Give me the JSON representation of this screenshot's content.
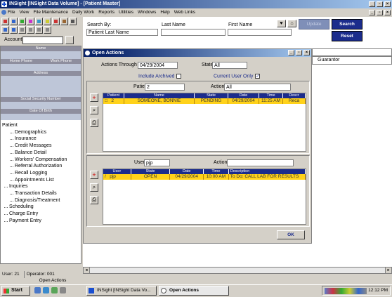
{
  "app": {
    "title": "INSight  [INSight Data Volume] - [Patient Master]",
    "menus": [
      "File",
      "View",
      "File Maintenance",
      "Daily Work",
      "Reports",
      "Utilities",
      "Windows",
      "Help",
      "Web Links"
    ],
    "window_buttons": [
      "_",
      "×"
    ]
  },
  "account": {
    "label": "Account",
    "value": ""
  },
  "sidebar": {
    "headers": {
      "name": "Name",
      "home_phone": "Home Phone",
      "work_phone": "Work Phone",
      "address": "Address",
      "ssn": "Social Security Number",
      "dob": "Date Of Birth"
    },
    "tree": [
      {
        "label": "Patient",
        "level": 0
      },
      {
        "label": "Demographics",
        "level": 2
      },
      {
        "label": "Insurance",
        "level": 2
      },
      {
        "label": "Credit Messages",
        "level": 2
      },
      {
        "label": "Balance Detail",
        "level": 2
      },
      {
        "label": "Workers' Compensation",
        "level": 2
      },
      {
        "label": "Referral Authorization",
        "level": 2
      },
      {
        "label": "Recall Logging",
        "level": 2
      },
      {
        "label": "Appointments List",
        "level": 2
      },
      {
        "label": "Inquiries",
        "level": 1
      },
      {
        "label": "Transaction Details",
        "level": 2
      },
      {
        "label": "Diagnosis/Treatment",
        "level": 2
      },
      {
        "label": "Scheduling",
        "level": 1
      },
      {
        "label": "Charge Entry",
        "level": 1
      },
      {
        "label": "Payment Entry",
        "level": 1
      }
    ]
  },
  "status": {
    "user": "User: 21",
    "operator": "Operator: 001",
    "open_label": "Open Actions"
  },
  "search": {
    "by_label": "Search By:",
    "by_value": "Patient Last Name",
    "last_name_label": "Last Name",
    "first_name_label": "First Name",
    "update_label": "Update",
    "search_label": "Search",
    "reset_label": "Reset"
  },
  "guarantor_label": "Guarantor",
  "dialog": {
    "title": "Open Actions",
    "actions_through_label": "Actions Through",
    "actions_through_value": "04/29/2004",
    "state_label": "State",
    "state_value": "All",
    "include_archived_label": "Include Archived",
    "current_user_only_label": "Current User Only",
    "current_user_only_checked": "✓",
    "patient_label": "Patient",
    "patient_value": "2",
    "action_label": "Action",
    "action_value": "All",
    "patient_grid": {
      "headers": [
        "Patient",
        "Name",
        "State",
        "Date",
        "Time",
        "Descr"
      ],
      "row": [
        "2",
        "SOMEONE, BONNIE",
        "PENDING",
        "04/29/2004",
        "11:25 AM",
        "Reca"
      ],
      "row_marker": "□"
    },
    "user_label": "User",
    "user_value": "pjp",
    "action2_label": "Action",
    "action2_value": "",
    "user_grid": {
      "headers": [
        "User",
        "State",
        "Date",
        "Time",
        "Description"
      ],
      "row": [
        "pjp",
        "OPEN",
        "04/29/2004",
        "10:00 AM",
        "To Do: CALL LAB FOR RESULTS"
      ],
      "row_marker": "/"
    },
    "ok_label": "OK",
    "add_symbol": "+",
    "find_symbol": "⌕",
    "print_symbol": "⎙"
  },
  "taskbar": {
    "start_label": "Start",
    "task1": "INSight  [INSight Data Vo...",
    "task2": "Open Actions",
    "clock": "12:12 PM"
  }
}
